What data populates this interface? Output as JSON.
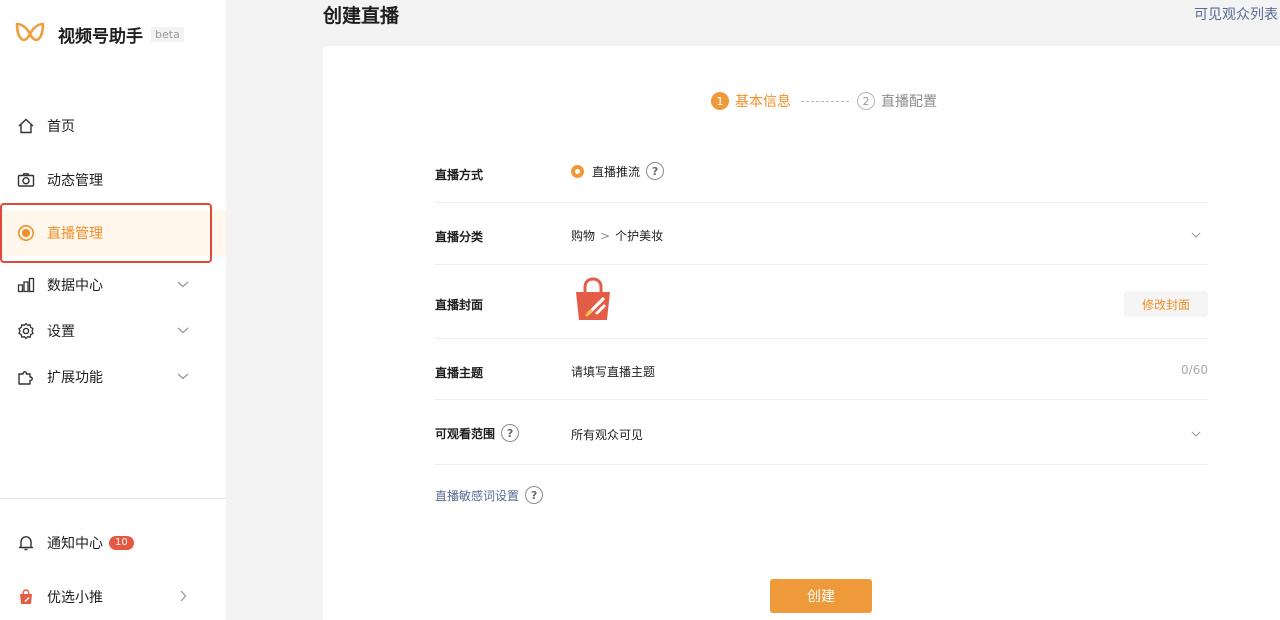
{
  "sidebar": {
    "brand": {
      "name": "视频号助手",
      "badge": "beta",
      "logo_icon": "channels-logo-icon",
      "logo_color": "#f0a040"
    },
    "items": [
      {
        "label": "首页",
        "icon": "home-icon"
      },
      {
        "label": "动态管理",
        "icon": "camera-icon"
      },
      {
        "label": "直播管理",
        "icon": "live-icon",
        "active": true
      },
      {
        "label": "数据中心",
        "icon": "bar-chart-icon",
        "expandable": true
      },
      {
        "label": "设置",
        "icon": "gear-icon",
        "expandable": true
      },
      {
        "label": "扩展功能",
        "icon": "puzzle-icon",
        "expandable": true
      }
    ],
    "footer": [
      {
        "label": "通知中心",
        "icon": "bell-icon",
        "badge": "10"
      },
      {
        "label": "优选小推",
        "icon": "shopping-bag-icon"
      }
    ]
  },
  "header": {
    "title": "创建直播",
    "link": "可见观众列表"
  },
  "steps": [
    {
      "number": "1",
      "label": "基本信息",
      "active": true
    },
    {
      "number": "2",
      "label": "直播配置",
      "active": false
    }
  ],
  "form": {
    "mode": {
      "label": "直播方式",
      "value": "直播推流",
      "help": "?"
    },
    "category": {
      "label": "直播分类",
      "parent": "购物",
      "separator": ">",
      "child": "个护美妆"
    },
    "cover": {
      "label": "直播封面",
      "button": "修改封面"
    },
    "topic": {
      "label": "直播主题",
      "placeholder": "请填写直播主题",
      "counter": "0/60"
    },
    "visibility": {
      "label": "可观看范围",
      "value": "所有观众可见",
      "help": "?"
    },
    "sensitive_words": {
      "label": "直播敏感词设置",
      "help": "?"
    }
  },
  "create_button": "创建",
  "colors": {
    "accent": "#ee9a3a",
    "link": "#576b95",
    "highlight": "#e0483a",
    "badge": "#e45844"
  }
}
